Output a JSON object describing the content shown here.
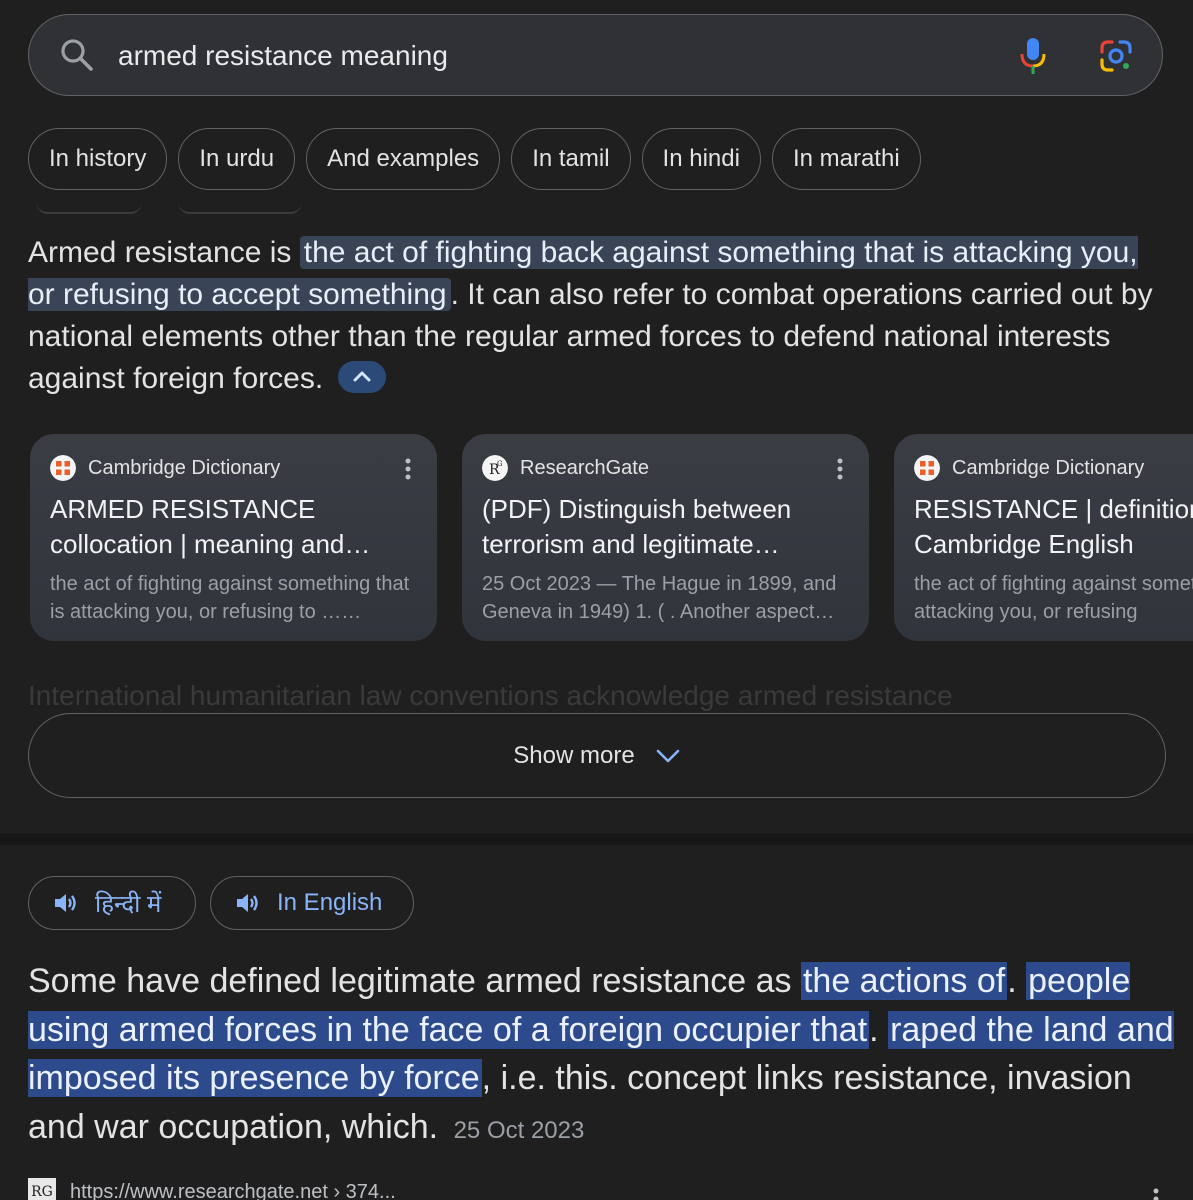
{
  "search": {
    "query": "armed resistance meaning"
  },
  "chips": [
    "In history",
    "In urdu",
    "And examples",
    "In tamil",
    "In hindi",
    "In marathi"
  ],
  "answer": {
    "prefix": "Armed resistance is ",
    "highlight": "the act of fighting back against something that is attacking you, or refusing to accept something",
    "rest": ". It can also refer to combat operations carried out by national elements other than the regular armed forces to defend national interests against foreign forces."
  },
  "cards": [
    {
      "source": "Cambridge Dictionary",
      "title": "ARMED RESISTANCE collocation | meaning and…",
      "snippet": "the act of fighting against something that is attacking you, or refusing to ……"
    },
    {
      "source": "ResearchGate",
      "title": "(PDF) Distinguish between terrorism and legitimate…",
      "snippet": "25 Oct 2023 — The Hague in 1899, and Geneva in 1949) 1. ( . Another aspect…"
    },
    {
      "source": "Cambridge Dictionary",
      "title": "RESISTANCE | definition in the Cambridge English",
      "snippet": "the act of fighting against something that is attacking you, or refusing"
    }
  ],
  "faded_text": "International humanitarian law conventions acknowledge armed resistance",
  "show_more": "Show more",
  "audio": {
    "hindi": "हिन्दी में",
    "english": "In English"
  },
  "quote": {
    "part1": "Some have defined legitimate armed resistance as ",
    "hl1": "the actions of",
    "part2": ". ",
    "hl2": "people using armed forces in the face of a foreign occupier that",
    "part3": ". ",
    "hl3": "raped the land and imposed its presence by force",
    "part4": ", i.e. this. concept links resistance, invasion and war occupation, which.",
    "date": "25 Oct 2023"
  },
  "source_url": {
    "logo": "RG",
    "text": "https://www.researchgate.net › 374..."
  }
}
